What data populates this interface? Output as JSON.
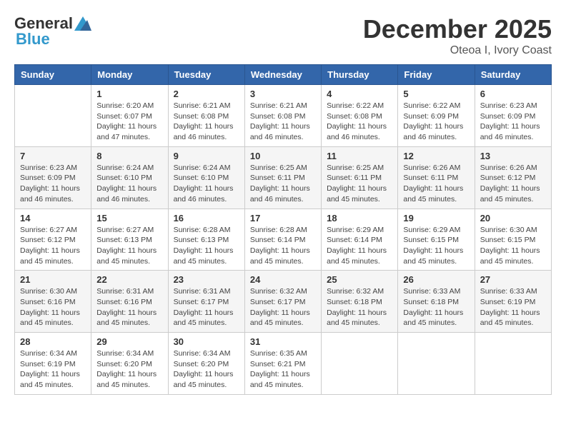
{
  "header": {
    "logo_general": "General",
    "logo_blue": "Blue",
    "month_title": "December 2025",
    "location": "Oteoa I, Ivory Coast"
  },
  "days_of_week": [
    "Sunday",
    "Monday",
    "Tuesday",
    "Wednesday",
    "Thursday",
    "Friday",
    "Saturday"
  ],
  "weeks": [
    [
      {
        "day": "",
        "info": ""
      },
      {
        "day": "1",
        "info": "Sunrise: 6:20 AM\nSunset: 6:07 PM\nDaylight: 11 hours and 47 minutes."
      },
      {
        "day": "2",
        "info": "Sunrise: 6:21 AM\nSunset: 6:08 PM\nDaylight: 11 hours and 46 minutes."
      },
      {
        "day": "3",
        "info": "Sunrise: 6:21 AM\nSunset: 6:08 PM\nDaylight: 11 hours and 46 minutes."
      },
      {
        "day": "4",
        "info": "Sunrise: 6:22 AM\nSunset: 6:08 PM\nDaylight: 11 hours and 46 minutes."
      },
      {
        "day": "5",
        "info": "Sunrise: 6:22 AM\nSunset: 6:09 PM\nDaylight: 11 hours and 46 minutes."
      },
      {
        "day": "6",
        "info": "Sunrise: 6:23 AM\nSunset: 6:09 PM\nDaylight: 11 hours and 46 minutes."
      }
    ],
    [
      {
        "day": "7",
        "info": "Sunrise: 6:23 AM\nSunset: 6:09 PM\nDaylight: 11 hours and 46 minutes."
      },
      {
        "day": "8",
        "info": "Sunrise: 6:24 AM\nSunset: 6:10 PM\nDaylight: 11 hours and 46 minutes."
      },
      {
        "day": "9",
        "info": "Sunrise: 6:24 AM\nSunset: 6:10 PM\nDaylight: 11 hours and 46 minutes."
      },
      {
        "day": "10",
        "info": "Sunrise: 6:25 AM\nSunset: 6:11 PM\nDaylight: 11 hours and 46 minutes."
      },
      {
        "day": "11",
        "info": "Sunrise: 6:25 AM\nSunset: 6:11 PM\nDaylight: 11 hours and 45 minutes."
      },
      {
        "day": "12",
        "info": "Sunrise: 6:26 AM\nSunset: 6:11 PM\nDaylight: 11 hours and 45 minutes."
      },
      {
        "day": "13",
        "info": "Sunrise: 6:26 AM\nSunset: 6:12 PM\nDaylight: 11 hours and 45 minutes."
      }
    ],
    [
      {
        "day": "14",
        "info": "Sunrise: 6:27 AM\nSunset: 6:12 PM\nDaylight: 11 hours and 45 minutes."
      },
      {
        "day": "15",
        "info": "Sunrise: 6:27 AM\nSunset: 6:13 PM\nDaylight: 11 hours and 45 minutes."
      },
      {
        "day": "16",
        "info": "Sunrise: 6:28 AM\nSunset: 6:13 PM\nDaylight: 11 hours and 45 minutes."
      },
      {
        "day": "17",
        "info": "Sunrise: 6:28 AM\nSunset: 6:14 PM\nDaylight: 11 hours and 45 minutes."
      },
      {
        "day": "18",
        "info": "Sunrise: 6:29 AM\nSunset: 6:14 PM\nDaylight: 11 hours and 45 minutes."
      },
      {
        "day": "19",
        "info": "Sunrise: 6:29 AM\nSunset: 6:15 PM\nDaylight: 11 hours and 45 minutes."
      },
      {
        "day": "20",
        "info": "Sunrise: 6:30 AM\nSunset: 6:15 PM\nDaylight: 11 hours and 45 minutes."
      }
    ],
    [
      {
        "day": "21",
        "info": "Sunrise: 6:30 AM\nSunset: 6:16 PM\nDaylight: 11 hours and 45 minutes."
      },
      {
        "day": "22",
        "info": "Sunrise: 6:31 AM\nSunset: 6:16 PM\nDaylight: 11 hours and 45 minutes."
      },
      {
        "day": "23",
        "info": "Sunrise: 6:31 AM\nSunset: 6:17 PM\nDaylight: 11 hours and 45 minutes."
      },
      {
        "day": "24",
        "info": "Sunrise: 6:32 AM\nSunset: 6:17 PM\nDaylight: 11 hours and 45 minutes."
      },
      {
        "day": "25",
        "info": "Sunrise: 6:32 AM\nSunset: 6:18 PM\nDaylight: 11 hours and 45 minutes."
      },
      {
        "day": "26",
        "info": "Sunrise: 6:33 AM\nSunset: 6:18 PM\nDaylight: 11 hours and 45 minutes."
      },
      {
        "day": "27",
        "info": "Sunrise: 6:33 AM\nSunset: 6:19 PM\nDaylight: 11 hours and 45 minutes."
      }
    ],
    [
      {
        "day": "28",
        "info": "Sunrise: 6:34 AM\nSunset: 6:19 PM\nDaylight: 11 hours and 45 minutes."
      },
      {
        "day": "29",
        "info": "Sunrise: 6:34 AM\nSunset: 6:20 PM\nDaylight: 11 hours and 45 minutes."
      },
      {
        "day": "30",
        "info": "Sunrise: 6:34 AM\nSunset: 6:20 PM\nDaylight: 11 hours and 45 minutes."
      },
      {
        "day": "31",
        "info": "Sunrise: 6:35 AM\nSunset: 6:21 PM\nDaylight: 11 hours and 45 minutes."
      },
      {
        "day": "",
        "info": ""
      },
      {
        "day": "",
        "info": ""
      },
      {
        "day": "",
        "info": ""
      }
    ]
  ]
}
